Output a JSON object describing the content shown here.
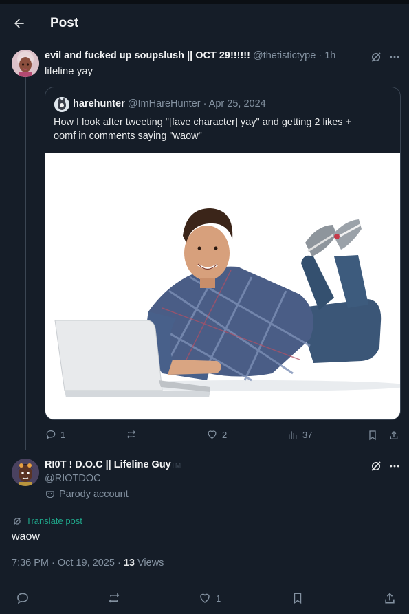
{
  "header": {
    "title": "Post"
  },
  "main_post": {
    "author_name": "evil and fucked up soupslush || OCT 29!!!!!!",
    "handle": "@thetistictype",
    "separator": "·",
    "time": "1h",
    "text": "lifeline yay",
    "quote": {
      "author_name": "harehunter",
      "handle": "@ImHareHunter",
      "separator": "·",
      "date": "Apr 25, 2024",
      "text_line1": "How I look after tweeting \"[fave character] yay\" and getting 2 likes +",
      "text_line2": "oomf in comments saying \"waow\""
    },
    "actions": {
      "replies": "1",
      "likes": "2",
      "views": "37"
    }
  },
  "reply_post": {
    "author_name": "RI0T ! D.O.C || Lifeline Guy",
    "trademark": "TM",
    "handle": "@RIOTDOC",
    "parody_label": "Parody account",
    "translate_label": "Translate post",
    "text": "waow",
    "time": "7:36 PM",
    "separator": "·",
    "date": "Oct 19, 2025",
    "views_count": "13",
    "views_label": "Views",
    "actions": {
      "likes": "1"
    }
  },
  "colors": {
    "background": "#151d28",
    "muted": "#8391a0",
    "translate": "#1fa68a",
    "border": "#3a4553"
  }
}
